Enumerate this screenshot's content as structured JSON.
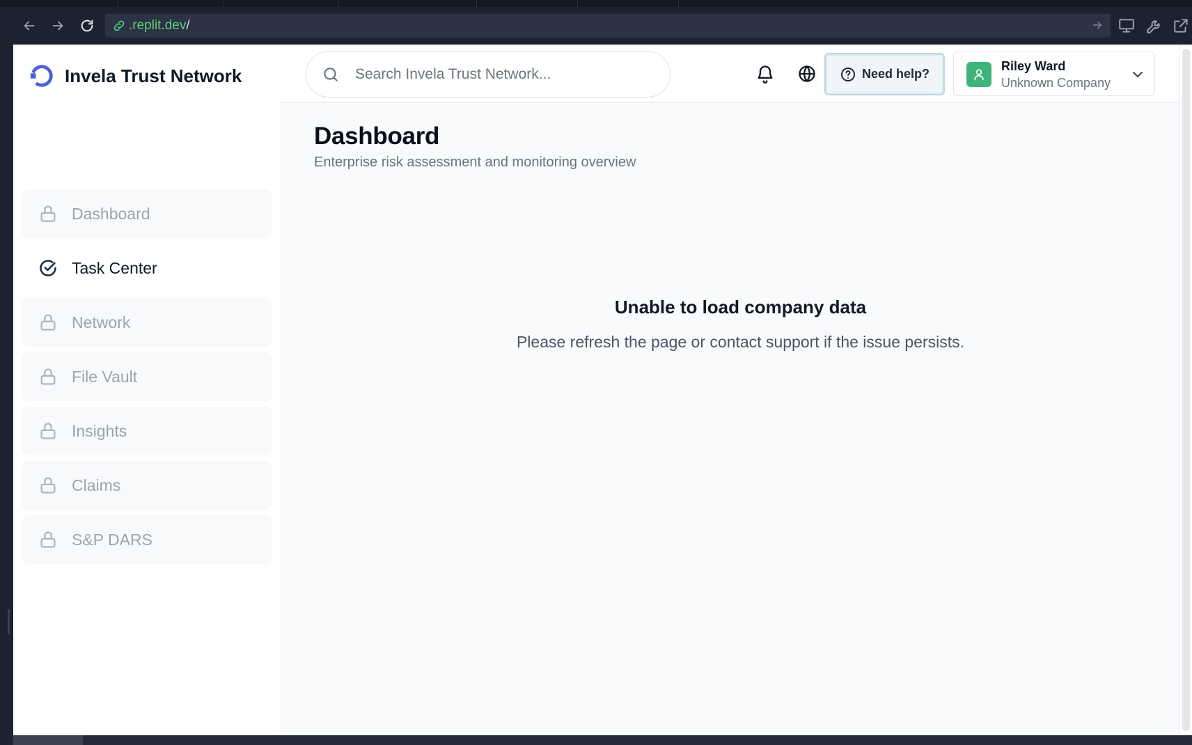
{
  "browser": {
    "url_host": ".replit.dev",
    "url_path": "/",
    "icons": [
      "back-icon",
      "forward-icon",
      "reload-icon",
      "link-icon",
      "go-arrow-icon",
      "devices-icon",
      "wrench-icon",
      "external-link-icon"
    ]
  },
  "app": {
    "brand": "Invela Trust Network",
    "colors": {
      "accent": "#4c5fd7",
      "avatar": "#3fb37a",
      "active_icon": "#1f2a55"
    }
  },
  "sidebar": {
    "items": [
      {
        "label": "Dashboard",
        "icon": "lock-icon",
        "locked": true
      },
      {
        "label": "Task Center",
        "icon": "check-circle-icon",
        "locked": false,
        "active": true
      },
      {
        "label": "Network",
        "icon": "lock-icon",
        "locked": true
      },
      {
        "label": "File Vault",
        "icon": "lock-icon",
        "locked": true
      },
      {
        "label": "Insights",
        "icon": "lock-icon",
        "locked": true
      },
      {
        "label": "Claims",
        "icon": "lock-icon",
        "locked": true
      },
      {
        "label": "S&P DARS",
        "icon": "lock-icon",
        "locked": true
      }
    ]
  },
  "header": {
    "search_placeholder": "Search Invela Trust Network...",
    "help_label": "Need help?",
    "user": {
      "name": "Riley Ward",
      "company": "Unknown Company"
    }
  },
  "main": {
    "title": "Dashboard",
    "subtitle": "Enterprise risk assessment and monitoring overview",
    "error_title": "Unable to load company data",
    "error_message": "Please refresh the page or contact support if the issue persists."
  }
}
